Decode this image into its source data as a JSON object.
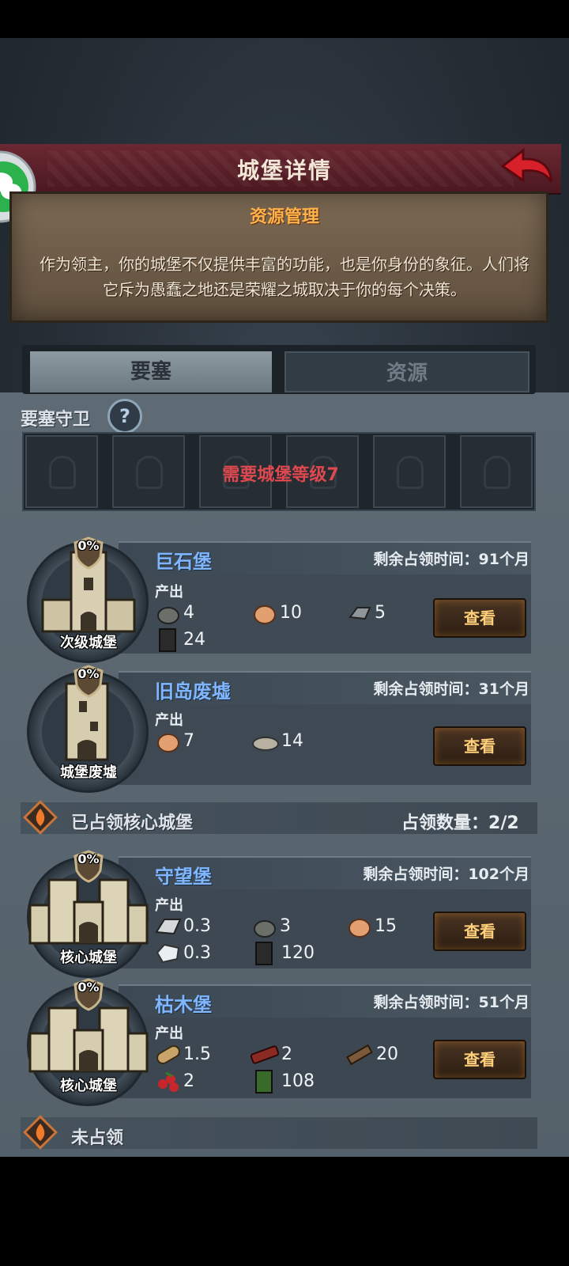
{
  "header": {
    "title": "城堡详情",
    "intro_heading": "资源管理",
    "intro_line1": "作为领主，你的城堡不仅提供丰富的功能，也是你身份的象征。人们将",
    "intro_line2": "它斥为愚蠢之地还是荣耀之城取决于你的每个决策。"
  },
  "tabs": [
    {
      "label": "要塞",
      "active": true
    },
    {
      "label": "资源",
      "active": false
    }
  ],
  "guard": {
    "title": "要塞守卫",
    "help": "?",
    "lock_text": "需要城堡等级7"
  },
  "castles_top": [
    {
      "name": "巨石堡",
      "type": "次级城堡",
      "percent": "0%",
      "remain_label": "剩余占领时间：",
      "remain_value": "91个月",
      "output_label": "产出",
      "resources": [
        {
          "icon": "stone-icon",
          "value": "4"
        },
        {
          "icon": "ore-icon",
          "value": "10"
        },
        {
          "icon": "iron-ingot-icon",
          "value": "5"
        },
        {
          "icon": "soldier-banner-icon",
          "value": "24"
        }
      ],
      "button": "查看"
    },
    {
      "name": "旧岛废墟",
      "type": "城堡废墟",
      "percent": "0%",
      "remain_label": "剩余占领时间：",
      "remain_value": "31个月",
      "output_label": "产出",
      "resources": [
        {
          "icon": "ore-icon",
          "value": "7"
        },
        {
          "icon": "clay-icon",
          "value": "14"
        }
      ],
      "button": "查看"
    }
  ],
  "core_section": {
    "title": "已占领核心城堡",
    "count_label": "占领数量：",
    "count_value": "2/2"
  },
  "castles_core": [
    {
      "name": "守望堡",
      "type": "核心城堡",
      "percent": "0%",
      "remain_label": "剩余占领时间：",
      "remain_value": "102个月",
      "output_label": "产出",
      "resources": [
        {
          "icon": "silver-ingot-icon",
          "value": "0.3"
        },
        {
          "icon": "stone-icon",
          "value": "3"
        },
        {
          "icon": "ore-icon",
          "value": "15"
        },
        {
          "icon": "diamond-icon",
          "value": "0.3"
        },
        {
          "icon": "soldier-banner-icon",
          "value": "120"
        }
      ],
      "button": "查看"
    },
    {
      "name": "枯木堡",
      "type": "核心城堡",
      "percent": "0%",
      "remain_label": "剩余占领时间：",
      "remain_value": "51个月",
      "output_label": "产出",
      "resources": [
        {
          "icon": "log-icon",
          "value": "1.5"
        },
        {
          "icon": "red-wood-icon",
          "value": "2"
        },
        {
          "icon": "plank-icon",
          "value": "20"
        },
        {
          "icon": "berries-icon",
          "value": "2"
        },
        {
          "icon": "green-banner-icon",
          "value": "108"
        }
      ],
      "button": "查看"
    }
  ],
  "unoccupied_section": {
    "title": "未占领"
  },
  "colors": {
    "title_bar": "#5a2028",
    "castle_name": "#7fb6ff",
    "lock_text": "#e0484f",
    "intro_heading": "#ffb24a",
    "button_text": "#ffcf7a"
  }
}
